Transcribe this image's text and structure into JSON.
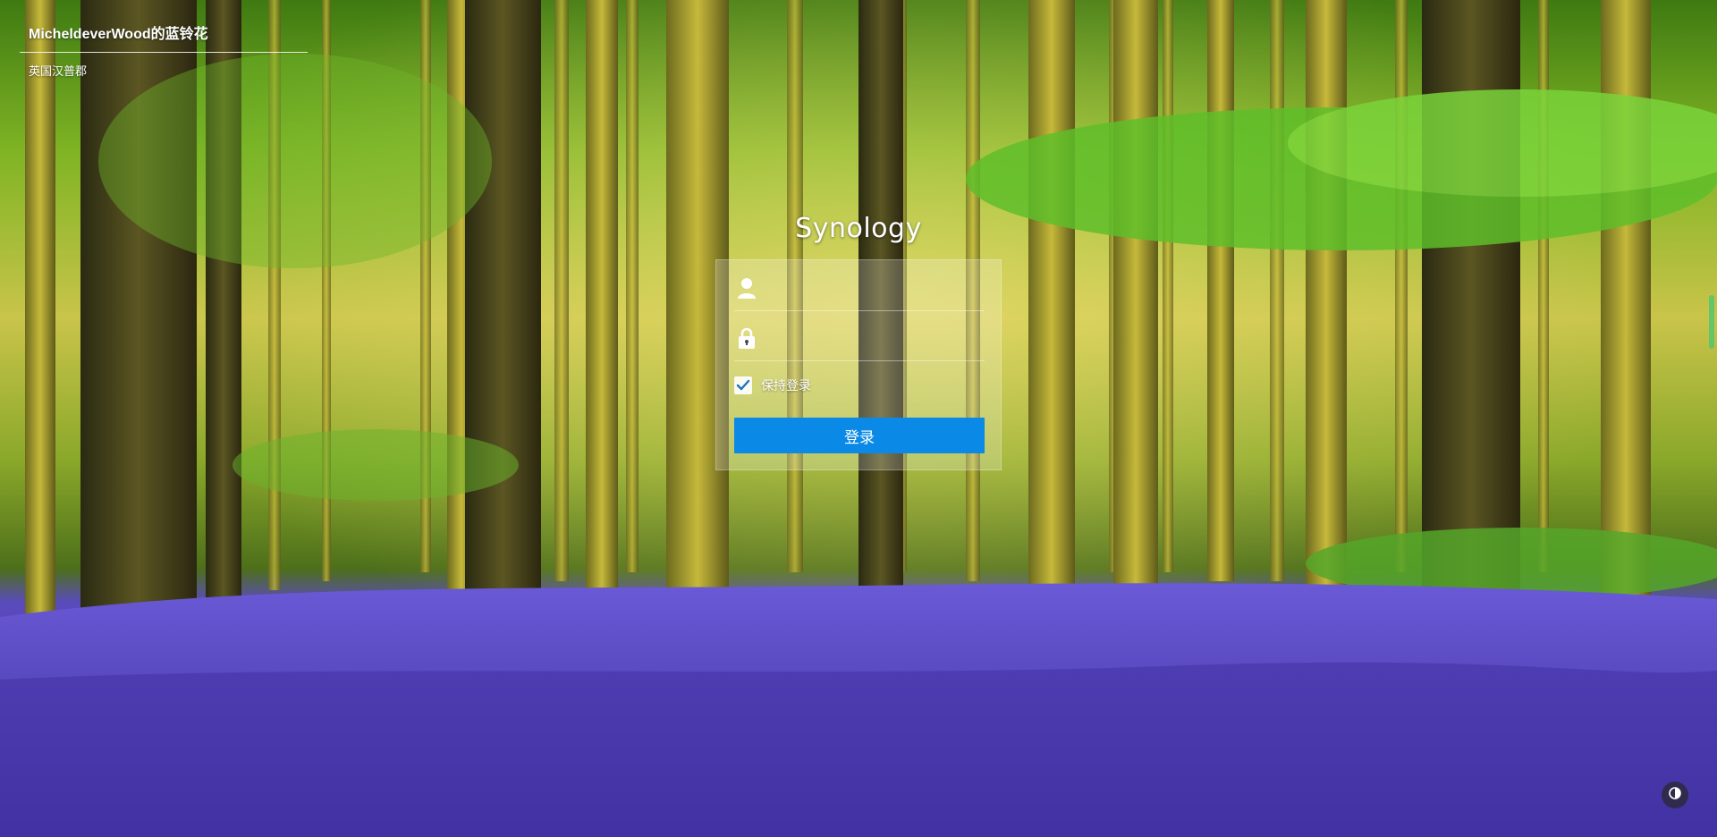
{
  "caption": {
    "title": "MicheldeverWood的蓝铃花",
    "subtitle": "英国汉普郡"
  },
  "login": {
    "brand": "Synology",
    "username_placeholder": "",
    "password_placeholder": "",
    "remember_label": "保持登录",
    "remember_checked": true,
    "submit_label": "登录"
  },
  "colors": {
    "accent": "#0a8ae6",
    "bluebell": "#5b4ccf",
    "foliage": "#7fbf2a"
  },
  "icons": {
    "user": "user-icon",
    "lock": "lock-icon",
    "check": "check-icon",
    "theme": "contrast-icon"
  }
}
